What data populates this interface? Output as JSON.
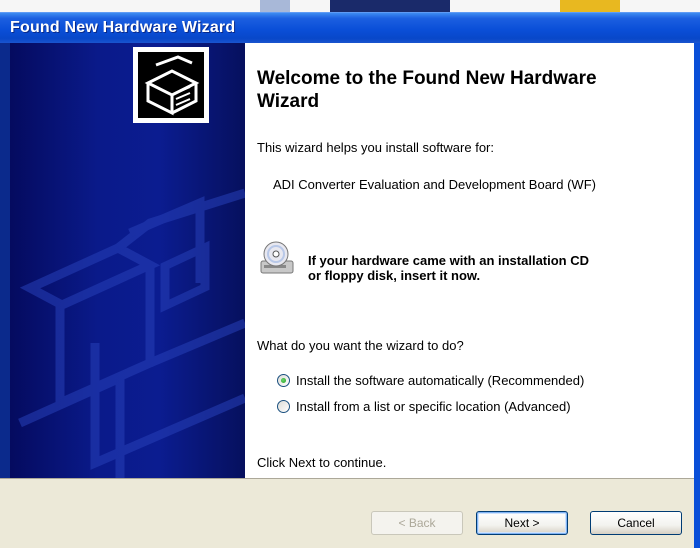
{
  "window": {
    "title": "Found New Hardware Wizard"
  },
  "heading": "Welcome to the Found New Hardware Wizard",
  "intro": "This wizard helps you install software for:",
  "device_name": "ADI Converter Evaluation and Development Board (WF)",
  "cd_prompt": {
    "icon": "cd-drive-icon",
    "line1": "If your hardware came with an installation CD",
    "line2": "or floppy disk, insert it now."
  },
  "question": "What do you want the wizard to do?",
  "options": [
    {
      "label": "Install the software automatically (Recommended)",
      "checked": true
    },
    {
      "label": "Install from a list or specific location (Advanced)",
      "checked": false
    }
  ],
  "continue_text": "Click Next to continue.",
  "buttons": {
    "back": "< Back",
    "next": "Next >",
    "cancel": "Cancel"
  },
  "colors": {
    "title_bar": "#0a4fd8",
    "side_panel": "#0b1c90",
    "button_bar": "#ece9d8"
  }
}
